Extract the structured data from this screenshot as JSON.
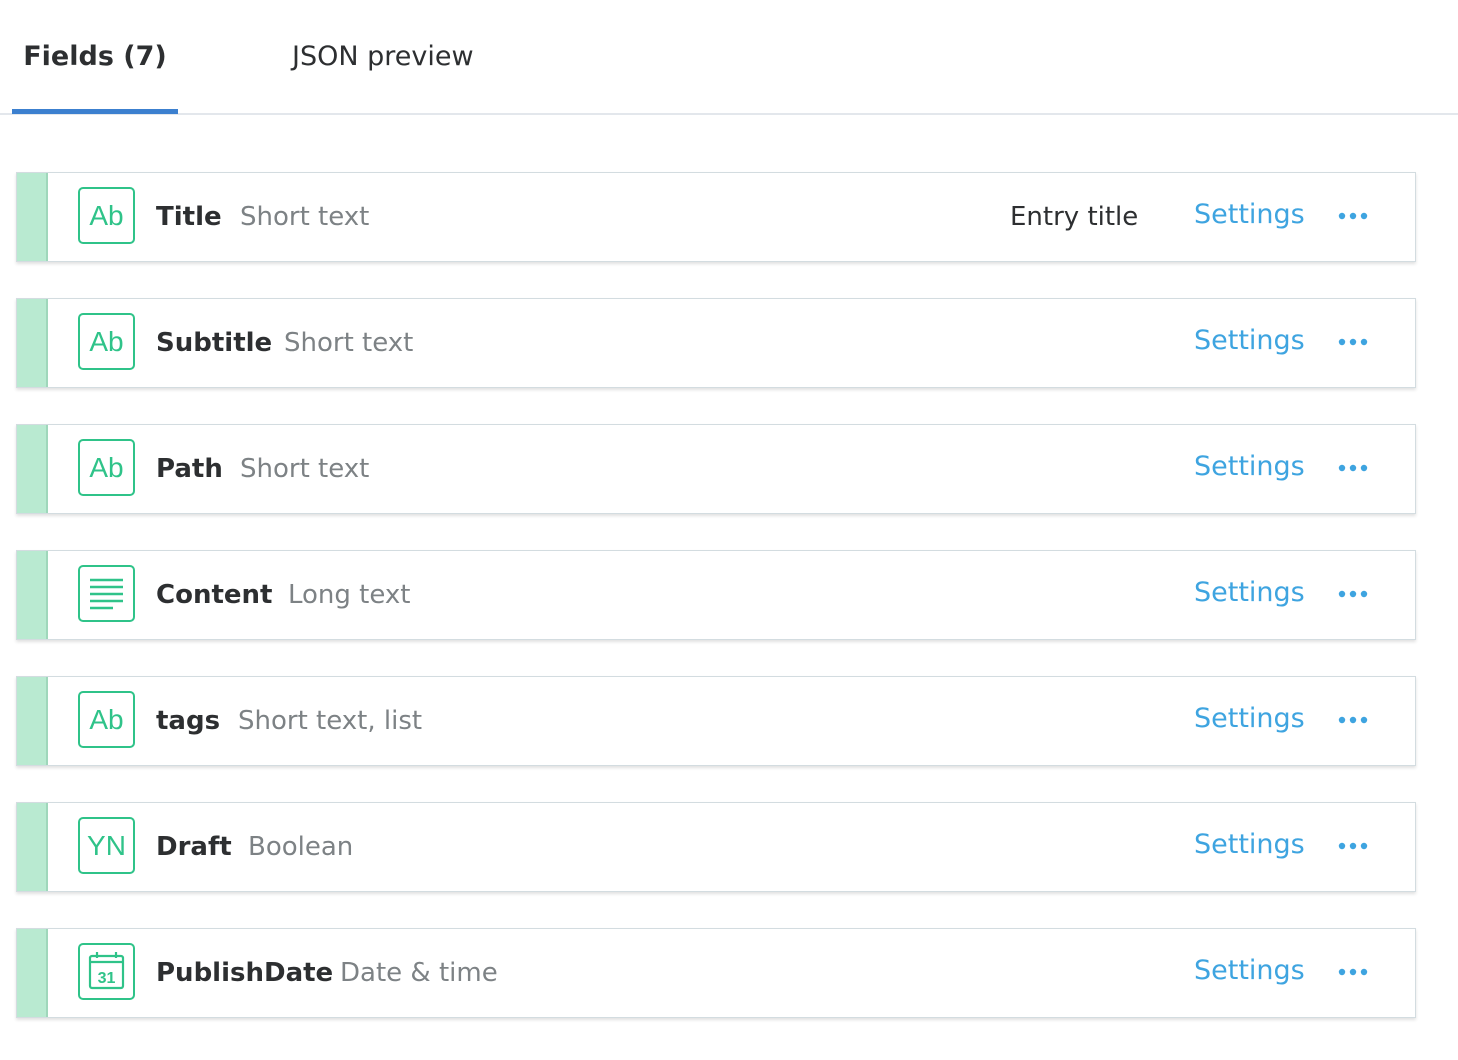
{
  "tabs": [
    {
      "label": "Fields (7)",
      "active": true
    },
    {
      "label": "JSON preview",
      "active": false
    }
  ],
  "fields": [
    {
      "name": "Title",
      "type": "Short text",
      "icon": "short-text-icon",
      "icon_text": "Ab",
      "badge": "Entry title",
      "settings_label": "Settings"
    },
    {
      "name": "Subtitle",
      "type": "Short text",
      "icon": "short-text-icon",
      "icon_text": "Ab",
      "badge": "",
      "settings_label": "Settings"
    },
    {
      "name": "Path",
      "type": "Short text",
      "icon": "short-text-icon",
      "icon_text": "Ab",
      "badge": "",
      "settings_label": "Settings"
    },
    {
      "name": "Content",
      "type": "Long text",
      "icon": "long-text-icon",
      "icon_text": "",
      "badge": "",
      "settings_label": "Settings"
    },
    {
      "name": "tags",
      "type": "Short text, list",
      "icon": "short-text-icon",
      "icon_text": "Ab",
      "badge": "",
      "settings_label": "Settings"
    },
    {
      "name": "Draft",
      "type": "Boolean",
      "icon": "boolean-icon",
      "icon_text": "YN",
      "badge": "",
      "settings_label": "Settings"
    },
    {
      "name": "PublishDate",
      "type": "Date & time",
      "icon": "calendar-icon",
      "icon_text": "31",
      "badge": "",
      "settings_label": "Settings"
    }
  ],
  "colors": {
    "accent_tab": "#3c80cf",
    "field_green": "#2fc389",
    "handle_green": "#b9ead1",
    "link_blue": "#3ea4e0"
  }
}
